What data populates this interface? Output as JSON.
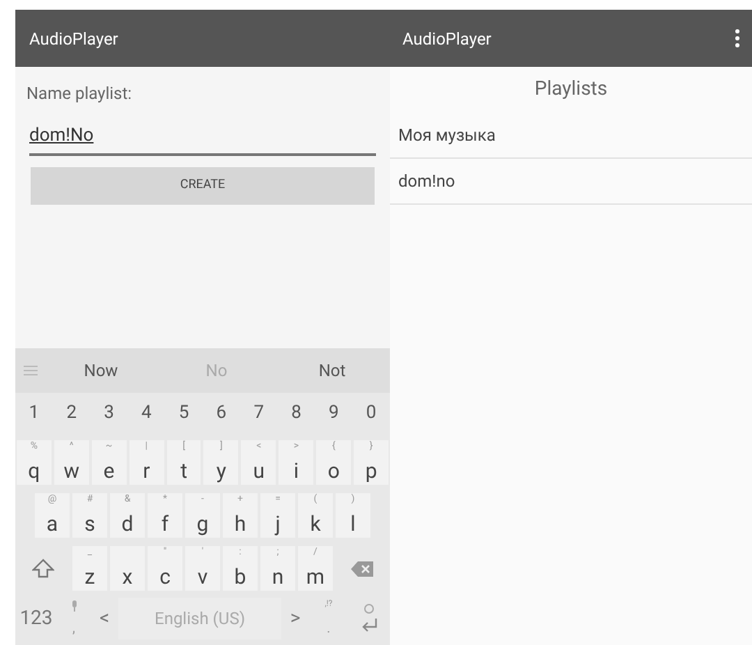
{
  "left_screen": {
    "app_bar": {
      "title": "AudioPlayer"
    },
    "label": "Name playlist:",
    "name_field": {
      "value": "dom!No"
    },
    "create_button": "CREATE",
    "keyboard": {
      "suggestions": [
        {
          "text": "Now",
          "selected": false
        },
        {
          "text": "No",
          "selected": true
        },
        {
          "text": "Not",
          "selected": false
        }
      ],
      "number_row": [
        "1",
        "2",
        "3",
        "4",
        "5",
        "6",
        "7",
        "8",
        "9",
        "0"
      ],
      "letter_rows": [
        [
          {
            "label": "q",
            "hint": "%"
          },
          {
            "label": "w",
            "hint": "^"
          },
          {
            "label": "e",
            "hint": "~"
          },
          {
            "label": "r",
            "hint": "|"
          },
          {
            "label": "t",
            "hint": "["
          },
          {
            "label": "y",
            "hint": "]"
          },
          {
            "label": "u",
            "hint": "<"
          },
          {
            "label": "i",
            "hint": ">"
          },
          {
            "label": "o",
            "hint": "{"
          },
          {
            "label": "p",
            "hint": "}"
          }
        ],
        [
          {
            "label": "a",
            "hint": "@"
          },
          {
            "label": "s",
            "hint": "#"
          },
          {
            "label": "d",
            "hint": "&"
          },
          {
            "label": "f",
            "hint": "*"
          },
          {
            "label": "g",
            "hint": "-"
          },
          {
            "label": "h",
            "hint": "+"
          },
          {
            "label": "j",
            "hint": "="
          },
          {
            "label": "k",
            "hint": "("
          },
          {
            "label": "l",
            "hint": ")"
          }
        ],
        [
          {
            "label": "z",
            "hint": "_"
          },
          {
            "label": "x"
          },
          {
            "label": "c",
            "hint": "\""
          },
          {
            "label": "v",
            "hint": "'"
          },
          {
            "label": "b",
            "hint": ":"
          },
          {
            "label": "n",
            "hint": ";"
          },
          {
            "label": "m",
            "hint": "/"
          }
        ]
      ],
      "bottom_row": {
        "symbols_key": "123",
        "comma_key": ",",
        "left_arrow": "<",
        "space_key": "English (US)",
        "right_arrow": ">",
        "period_key": ".",
        "period_hint": ",!?"
      }
    }
  },
  "right_screen": {
    "app_bar": {
      "title": "AudioPlayer"
    },
    "heading": "Playlists",
    "playlists": [
      "Моя музыка",
      "dom!no"
    ]
  }
}
